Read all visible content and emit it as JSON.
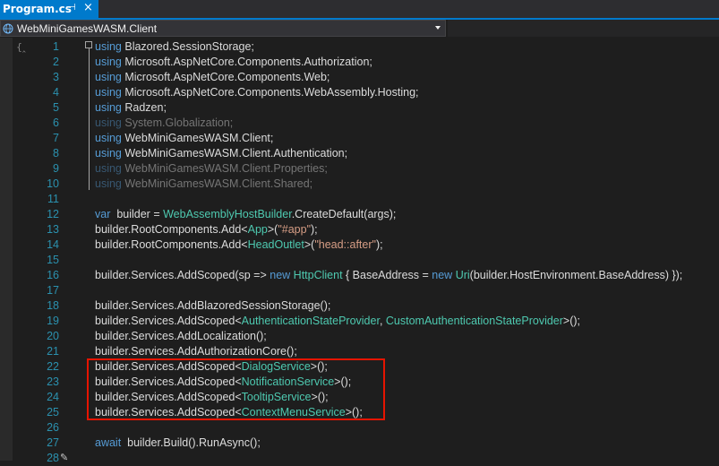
{
  "tab": {
    "title": "Program.cs",
    "pin_icon": "pin-icon",
    "close_icon": "close-icon"
  },
  "navbar": {
    "project": "WebMiniGamesWASM.Client"
  },
  "code_lines": [
    {
      "num": "1",
      "tokens": [
        [
          "kw",
          "using"
        ],
        [
          "",
          "Blazored.SessionStorage;"
        ]
      ]
    },
    {
      "num": "2",
      "tokens": [
        [
          "kw",
          "using"
        ],
        [
          "",
          "Microsoft.AspNetCore.Components.Authorization;"
        ]
      ]
    },
    {
      "num": "3",
      "tokens": [
        [
          "kw",
          "using"
        ],
        [
          "",
          "Microsoft.AspNetCore.Components.Web;"
        ]
      ]
    },
    {
      "num": "4",
      "tokens": [
        [
          "kw",
          "using"
        ],
        [
          "",
          "Microsoft.AspNetCore.Components.WebAssembly.Hosting;"
        ]
      ]
    },
    {
      "num": "5",
      "tokens": [
        [
          "kw",
          "using"
        ],
        [
          "",
          "Radzen;"
        ]
      ]
    },
    {
      "num": "6",
      "dim": true,
      "tokens": [
        [
          "kw",
          "using"
        ],
        [
          "",
          "System.Globalization;"
        ]
      ]
    },
    {
      "num": "7",
      "tokens": [
        [
          "kw",
          "using"
        ],
        [
          "",
          "WebMiniGamesWASM.Client;"
        ]
      ]
    },
    {
      "num": "8",
      "tokens": [
        [
          "kw",
          "using"
        ],
        [
          "",
          "WebMiniGamesWASM.Client.Authentication;"
        ]
      ]
    },
    {
      "num": "9",
      "dim": true,
      "tokens": [
        [
          "kw",
          "using"
        ],
        [
          "",
          "WebMiniGamesWASM.Client.Properties;"
        ]
      ]
    },
    {
      "num": "10",
      "dim": true,
      "tokens": [
        [
          "kw",
          "using"
        ],
        [
          "",
          "WebMiniGamesWASM.Client.Shared;"
        ]
      ]
    },
    {
      "num": "11",
      "tokens": []
    },
    {
      "num": "12",
      "tokens": [
        [
          "kw",
          "var"
        ],
        [
          "",
          " builder = "
        ],
        [
          "ty",
          "WebAssemblyHostBuilder"
        ],
        [
          "",
          ".CreateDefault(args);"
        ]
      ]
    },
    {
      "num": "13",
      "tokens": [
        [
          "",
          "builder.RootComponents.Add<"
        ],
        [
          "ty",
          "App"
        ],
        [
          "",
          ">("
        ],
        [
          "st",
          "\"#app\""
        ],
        [
          "",
          ");"
        ]
      ]
    },
    {
      "num": "14",
      "tokens": [
        [
          "",
          "builder.RootComponents.Add<"
        ],
        [
          "ty",
          "HeadOutlet"
        ],
        [
          "",
          ">("
        ],
        [
          "st",
          "\"head::after\""
        ],
        [
          "",
          ");"
        ]
      ]
    },
    {
      "num": "15",
      "tokens": []
    },
    {
      "num": "16",
      "tokens": [
        [
          "",
          "builder.Services.AddScoped(sp => "
        ],
        [
          "kw",
          "new"
        ],
        [
          "",
          ""
        ],
        [
          "ty",
          " HttpClient"
        ],
        [
          "",
          " { BaseAddress = "
        ],
        [
          "kw",
          "new"
        ],
        [
          "ty",
          " Uri"
        ],
        [
          "",
          "(builder.HostEnvironment.BaseAddress) });"
        ]
      ]
    },
    {
      "num": "17",
      "tokens": []
    },
    {
      "num": "18",
      "tokens": [
        [
          "",
          "builder.Services.AddBlazoredSessionStorage();"
        ]
      ]
    },
    {
      "num": "19",
      "tokens": [
        [
          "",
          "builder.Services.AddScoped<"
        ],
        [
          "ty",
          "AuthenticationStateProvider"
        ],
        [
          "",
          ", "
        ],
        [
          "ty",
          "CustomAuthenticationStateProvider"
        ],
        [
          "",
          ">();"
        ]
      ]
    },
    {
      "num": "20",
      "tokens": [
        [
          "",
          "builder.Services.AddLocalization();"
        ]
      ]
    },
    {
      "num": "21",
      "tokens": [
        [
          "",
          "builder.Services.AddAuthorizationCore();"
        ]
      ]
    },
    {
      "num": "22",
      "tokens": [
        [
          "",
          "builder.Services.AddScoped<"
        ],
        [
          "ty",
          "DialogService"
        ],
        [
          "",
          ">();"
        ]
      ]
    },
    {
      "num": "23",
      "tokens": [
        [
          "",
          "builder.Services.AddScoped<"
        ],
        [
          "ty",
          "NotificationService"
        ],
        [
          "",
          ">();"
        ]
      ]
    },
    {
      "num": "24",
      "tokens": [
        [
          "",
          "builder.Services.AddScoped<"
        ],
        [
          "ty",
          "TooltipService"
        ],
        [
          "",
          ">();"
        ]
      ]
    },
    {
      "num": "25",
      "tokens": [
        [
          "",
          "builder.Services.AddScoped<"
        ],
        [
          "ty",
          "ContextMenuService"
        ],
        [
          "",
          ">();"
        ]
      ]
    },
    {
      "num": "26",
      "tokens": []
    },
    {
      "num": "27",
      "tokens": [
        [
          "kw",
          "await"
        ],
        [
          "",
          " builder.Build().RunAsync();"
        ]
      ]
    },
    {
      "num": "28",
      "tokens": []
    }
  ]
}
